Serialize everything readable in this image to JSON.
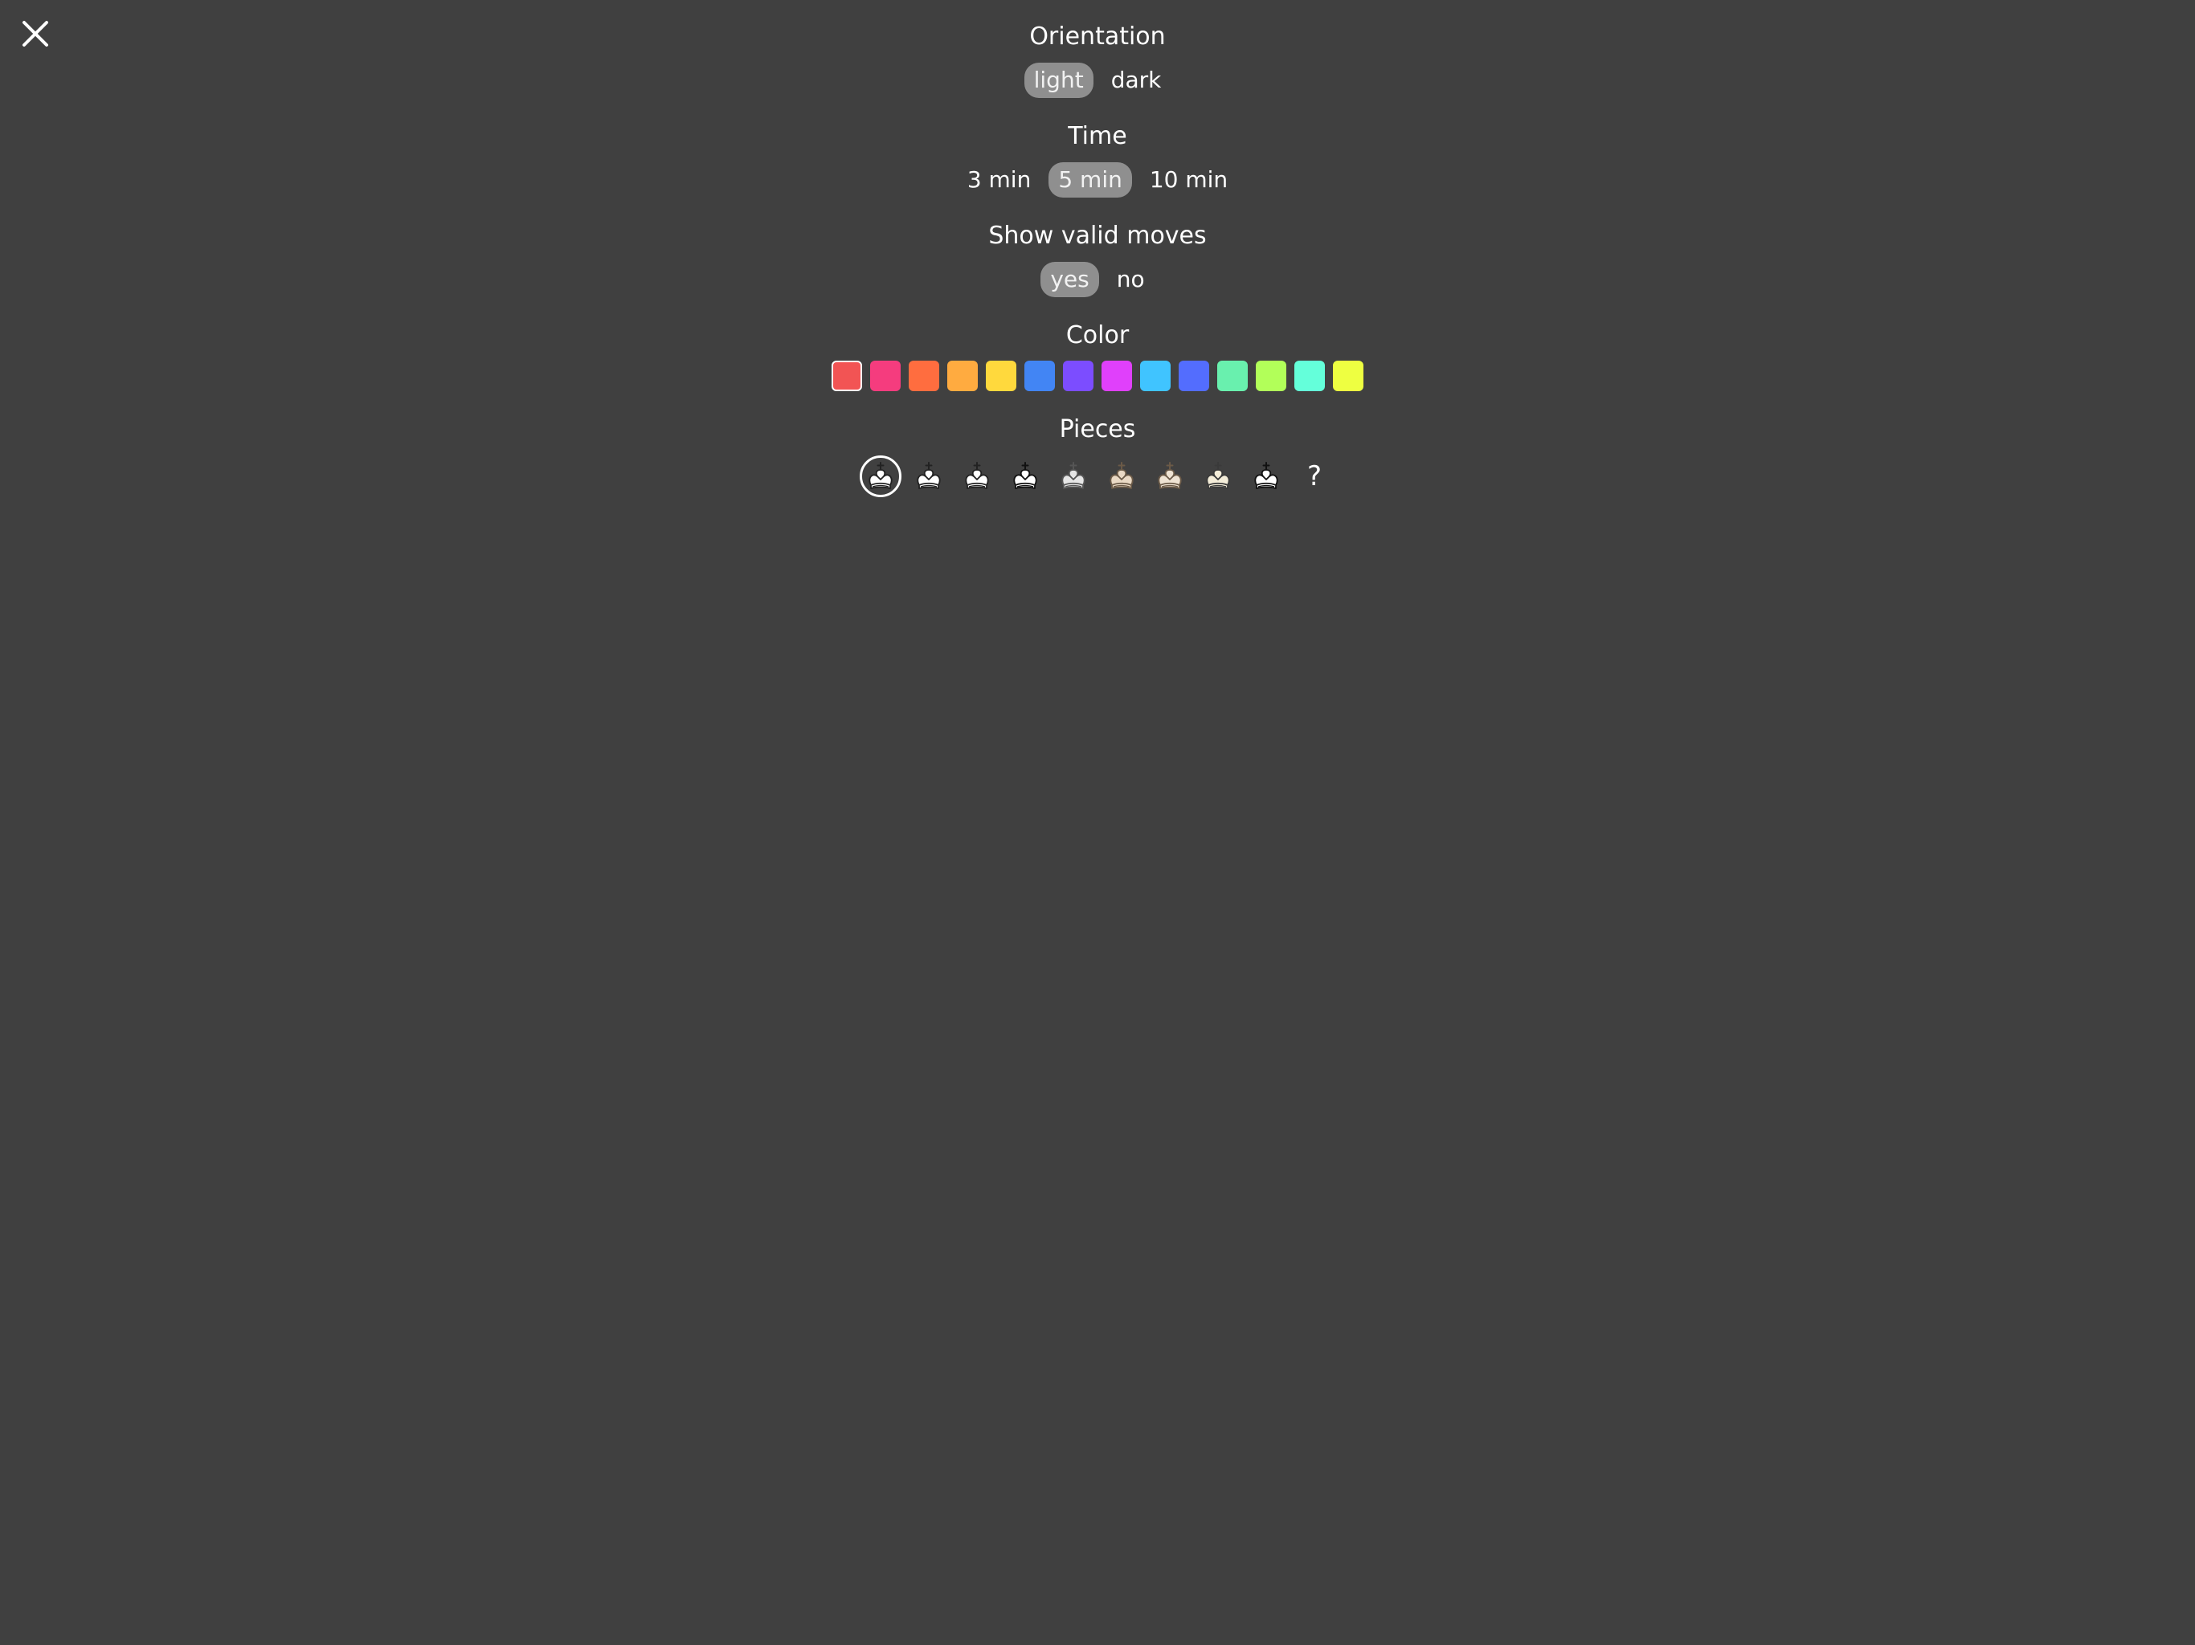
{
  "close": {
    "icon": "close-icon"
  },
  "orientation": {
    "title": "Orientation",
    "options": [
      "light",
      "dark"
    ],
    "selected": "light"
  },
  "time": {
    "title": "Time",
    "options": [
      "3 min",
      "5 min",
      "10 min"
    ],
    "selected": "5 min"
  },
  "valid_moves": {
    "title": "Show valid moves",
    "options": [
      "yes",
      "no"
    ],
    "selected": "yes"
  },
  "color": {
    "title": "Color",
    "swatches": [
      "#f25454",
      "#f53c7e",
      "#ff6d3f",
      "#ffab40",
      "#ffd93d",
      "#4285f4",
      "#7c4dff",
      "#e040fb",
      "#40c4ff",
      "#536dfe",
      "#69f0ae",
      "#b2ff59",
      "#64ffda",
      "#eeff41"
    ],
    "selected_index": 0
  },
  "pieces": {
    "title": "Pieces",
    "sets": [
      {
        "icon": "king-piece-icon",
        "fill": "#ffffff",
        "stroke": "#222222"
      },
      {
        "icon": "king-piece-icon",
        "fill": "#ffffff",
        "stroke": "#222222"
      },
      {
        "icon": "king-piece-icon",
        "fill": "#ffffff",
        "stroke": "#222222"
      },
      {
        "icon": "king-piece-icon",
        "fill": "#ffffff",
        "stroke": "#111111"
      },
      {
        "icon": "king-piece-icon",
        "fill": "#e6e6e6",
        "stroke": "#555555"
      },
      {
        "icon": "king-piece-icon",
        "fill": "#ead9c4",
        "stroke": "#6b5a47"
      },
      {
        "icon": "king-piece-icon",
        "fill": "#efe3d2",
        "stroke": "#6b5a47"
      },
      {
        "icon": "king-piece-icon",
        "fill": "#f4edd9",
        "stroke": "#3a3a3a"
      },
      {
        "icon": "king-piece-icon",
        "fill": "#ffffff",
        "stroke": "#111111"
      }
    ],
    "random_label": "?",
    "selected_index": 0
  }
}
